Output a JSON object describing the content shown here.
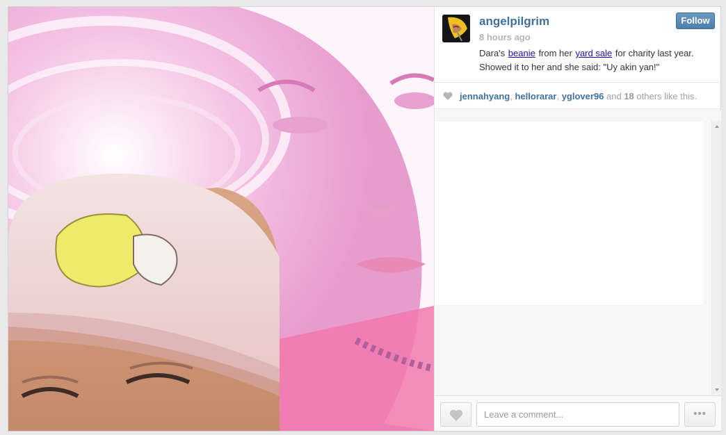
{
  "post": {
    "username": "angelpilgrim",
    "time": "8 hours ago",
    "follow_label": "Follow",
    "caption": {
      "part1": "Dara's ",
      "link1": "beanie",
      "part2": " from her ",
      "link2": "yard sale",
      "part3": " for charity last year. Showed it to her and she said: \"Uy akin yan!\""
    }
  },
  "likes": {
    "user1": "jennahyang",
    "sep1": ", ",
    "user2": "hellorarar",
    "sep2": ", ",
    "user3": "yglover96",
    "and_text": " and ",
    "count": "18",
    "others_text": " others like this."
  },
  "comment_box": {
    "placeholder": "Leave a comment...",
    "more_label": "•••"
  },
  "colors": {
    "username": "#3f729b",
    "follow_button": "#4d7eaa",
    "link": "#1a0dab"
  },
  "icons": {
    "like": "heart-icon",
    "more": "ellipsis-icon"
  }
}
